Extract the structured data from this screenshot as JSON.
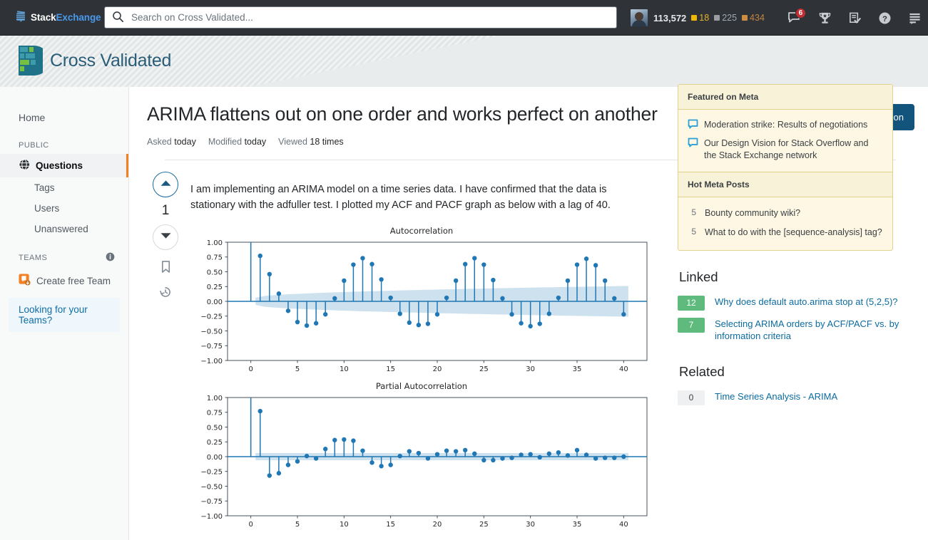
{
  "topbar": {
    "logo_stack": "Stack",
    "logo_exchange": "Exchange",
    "search_placeholder": "Search on Cross Validated...",
    "search_value": "",
    "reputation": "113,572",
    "gold_badges": "18",
    "silver_badges": "225",
    "bronze_badges": "434",
    "inbox_count": "6",
    "icons": [
      "inbox-icon",
      "achievements-trophy-icon",
      "review-queue-icon",
      "help-icon",
      "site-switcher-icon"
    ]
  },
  "siteheader": {
    "site_name": "Cross Validated"
  },
  "sidebar": {
    "home": "Home",
    "public_label": "PUBLIC",
    "items": [
      {
        "label": "Questions",
        "active": true
      },
      {
        "label": "Tags",
        "active": false
      },
      {
        "label": "Users",
        "active": false
      },
      {
        "label": "Unanswered",
        "active": false
      }
    ],
    "teams_label": "TEAMS",
    "create_team": "Create free Team",
    "looking_for_teams": "Looking for your Teams?"
  },
  "question": {
    "title": "ARIMA flattens out on one order and works perfect on another",
    "asked_label": "Asked",
    "asked_value": "today",
    "modified_label": "Modified",
    "modified_value": "today",
    "viewed_label": "Viewed",
    "viewed_value": "18 times",
    "ask_button": "Ask Question",
    "score": "1",
    "body": "I am implementing an ARIMA model on a time series data. I have confirmed that the data is stationary with the adfuller test. I plotted my ACF and PACF graph as below with a lag of 40."
  },
  "meta": {
    "featured_title": "Featured on Meta",
    "featured": [
      "Moderation strike: Results of negotiations",
      "Our Design Vision for Stack Overflow and the Stack Exchange network"
    ],
    "hot_title": "Hot Meta Posts",
    "hot": [
      {
        "votes": "5",
        "title": "Bounty community wiki?"
      },
      {
        "votes": "5",
        "title": "What to do with the [sequence-analysis] tag?"
      }
    ]
  },
  "linked": {
    "title": "Linked",
    "items": [
      {
        "votes": "12",
        "title": "Why does default auto.arima stop at (5,2,5)?"
      },
      {
        "votes": "7",
        "title": "Selecting ARIMA orders by ACF/PACF vs. by information criteria"
      }
    ]
  },
  "related": {
    "title": "Related",
    "items": [
      {
        "votes": "0",
        "title": "Time Series Analysis - ARIMA"
      }
    ]
  },
  "colors": {
    "accent_orange": "#f48024",
    "topbar_bg": "#2f3337",
    "site_teal": "#2a5d78",
    "plot_blue": "#1f77b4",
    "ask_button": "#13547d",
    "meta_bg": "#fdf7e3",
    "badge_green": "#5eba7d"
  },
  "chart_data": [
    {
      "type": "stem",
      "title": "Autocorrelation",
      "xlabel": "",
      "ylabel": "",
      "xlim": [
        -2.5,
        42.5
      ],
      "ylim": [
        -1.0,
        1.0
      ],
      "xticks": [
        0,
        5,
        10,
        15,
        20,
        25,
        30,
        35,
        40
      ],
      "yticks": [
        -1.0,
        -0.75,
        -0.5,
        -0.25,
        0.0,
        0.25,
        0.5,
        0.75,
        1.0
      ],
      "grid": false,
      "legend": "none",
      "x": [
        0,
        1,
        2,
        3,
        4,
        5,
        6,
        7,
        8,
        9,
        10,
        11,
        12,
        13,
        14,
        15,
        16,
        17,
        18,
        19,
        20,
        21,
        22,
        23,
        24,
        25,
        26,
        27,
        28,
        29,
        30,
        31,
        32,
        33,
        34,
        35,
        36,
        37,
        38,
        39,
        40
      ],
      "values": [
        1.0,
        0.77,
        0.46,
        0.13,
        -0.16,
        -0.35,
        -0.41,
        -0.37,
        -0.22,
        0.05,
        0.35,
        0.62,
        0.73,
        0.63,
        0.37,
        0.06,
        -0.21,
        -0.36,
        -0.4,
        -0.38,
        -0.22,
        0.06,
        0.35,
        0.63,
        0.73,
        0.62,
        0.36,
        0.05,
        -0.22,
        -0.37,
        -0.42,
        -0.38,
        -0.21,
        0.06,
        0.35,
        0.62,
        0.72,
        0.61,
        0.35,
        0.05,
        -0.22
      ],
      "confidence_band": {
        "note": "95% interval widening with lag",
        "start": 0.06,
        "end": 0.26
      }
    },
    {
      "type": "stem",
      "title": "Partial Autocorrelation",
      "xlabel": "",
      "ylabel": "",
      "xlim": [
        -2.5,
        42.5
      ],
      "ylim": [
        -1.0,
        1.0
      ],
      "xticks": [
        0,
        5,
        10,
        15,
        20,
        25,
        30,
        35,
        40
      ],
      "yticks": [
        -1.0,
        -0.75,
        -0.5,
        -0.25,
        0.0,
        0.25,
        0.5,
        0.75,
        1.0
      ],
      "grid": false,
      "legend": "none",
      "x": [
        0,
        1,
        2,
        3,
        4,
        5,
        6,
        7,
        8,
        9,
        10,
        11,
        12,
        13,
        14,
        15,
        16,
        17,
        18,
        19,
        20,
        21,
        22,
        23,
        24,
        25,
        26,
        27,
        28,
        29,
        30,
        31,
        32,
        33,
        34,
        35,
        36,
        37,
        38,
        39,
        40
      ],
      "values": [
        1.0,
        0.77,
        -0.32,
        -0.28,
        -0.14,
        -0.08,
        0.01,
        -0.03,
        0.13,
        0.28,
        0.29,
        0.27,
        0.1,
        -0.1,
        -0.16,
        -0.14,
        0.01,
        0.09,
        0.06,
        -0.03,
        0.04,
        0.1,
        0.09,
        0.11,
        0.05,
        -0.06,
        -0.06,
        -0.03,
        -0.02,
        0.03,
        0.04,
        -0.01,
        0.05,
        0.07,
        0.02,
        0.11,
        0.03,
        -0.03,
        -0.02,
        -0.02,
        0.0
      ],
      "confidence_band": {
        "note": "95% interval approximately constant",
        "start": 0.06,
        "end": 0.06
      }
    }
  ]
}
